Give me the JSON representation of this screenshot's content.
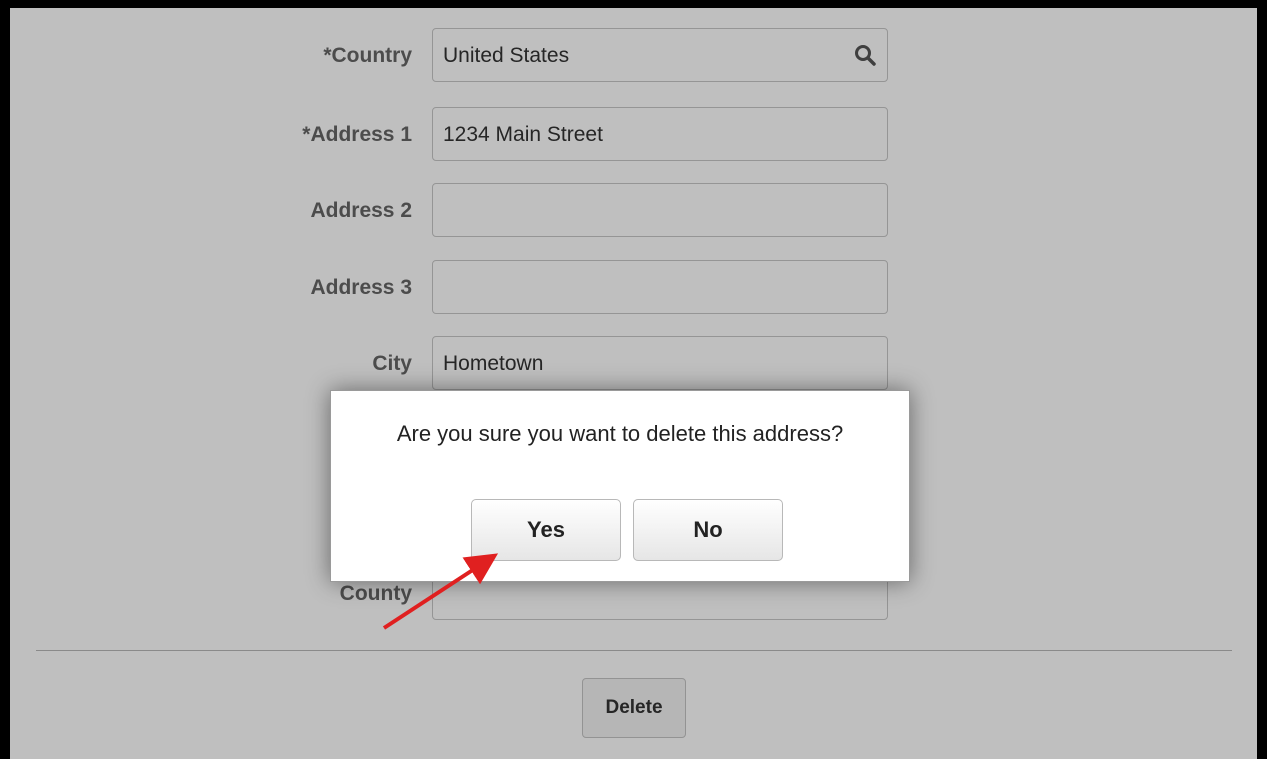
{
  "form": {
    "country": {
      "label": "*Country",
      "value": "United States"
    },
    "address1": {
      "label": "*Address 1",
      "value": "1234 Main Street"
    },
    "address2": {
      "label": "Address 2",
      "value": ""
    },
    "address3": {
      "label": "Address 3",
      "value": ""
    },
    "city": {
      "label": "City",
      "value": "Hometown"
    },
    "county": {
      "label": "County",
      "value": ""
    }
  },
  "actions": {
    "delete_label": "Delete"
  },
  "dialog": {
    "message": "Are you sure you want to delete this address?",
    "yes_label": "Yes",
    "no_label": "No"
  },
  "annotation": {
    "arrow_color": "#e02020"
  }
}
